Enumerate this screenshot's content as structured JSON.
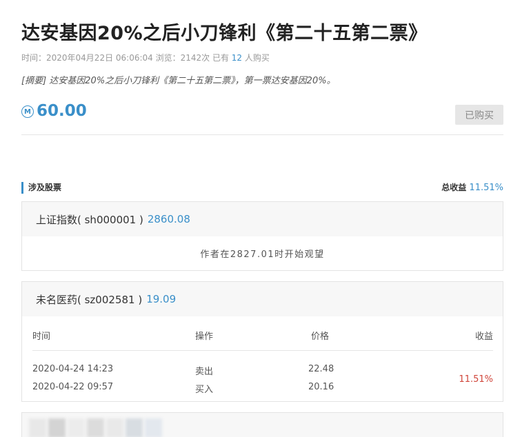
{
  "article": {
    "title": "达安基因20%之后小刀锋利《第二十五第二票》",
    "meta_prefix": "时间：2020年04月22日 06:06:04  浏览：2142次  已有 ",
    "buyer_count": "12",
    "meta_suffix": " 人购买",
    "summary_tag": "[摘要]",
    "summary_text": " 达安基因20%之后小刀锋利《第二十五第二票》，第一票达安基因20%。"
  },
  "price": {
    "icon": "coin-icon",
    "icon_glyph": "M",
    "value": "60.00",
    "button_label": "已购买"
  },
  "stocks_section": {
    "title": "涉及股票",
    "total_label": "总收益 ",
    "total_value": "11.51%"
  },
  "stock1": {
    "name": "上证指数( sh000001 )",
    "price": "2860.08",
    "note": "作者在2827.01时开始观望"
  },
  "stock2": {
    "name": "未名医药( sz002581 )",
    "price": "19.09",
    "headers": {
      "time": "时间",
      "action": "操作",
      "price": "价格",
      "profit": "收益"
    },
    "trades": [
      {
        "time": "2020-04-24 14:23",
        "action": "卖出",
        "price": "22.48"
      },
      {
        "time": "2020-04-22 09:57",
        "action": "买入",
        "price": "20.16"
      }
    ],
    "profit": "11.51%"
  },
  "colors": {
    "accent": "#3a8fc9",
    "profit": "#d0453a"
  }
}
